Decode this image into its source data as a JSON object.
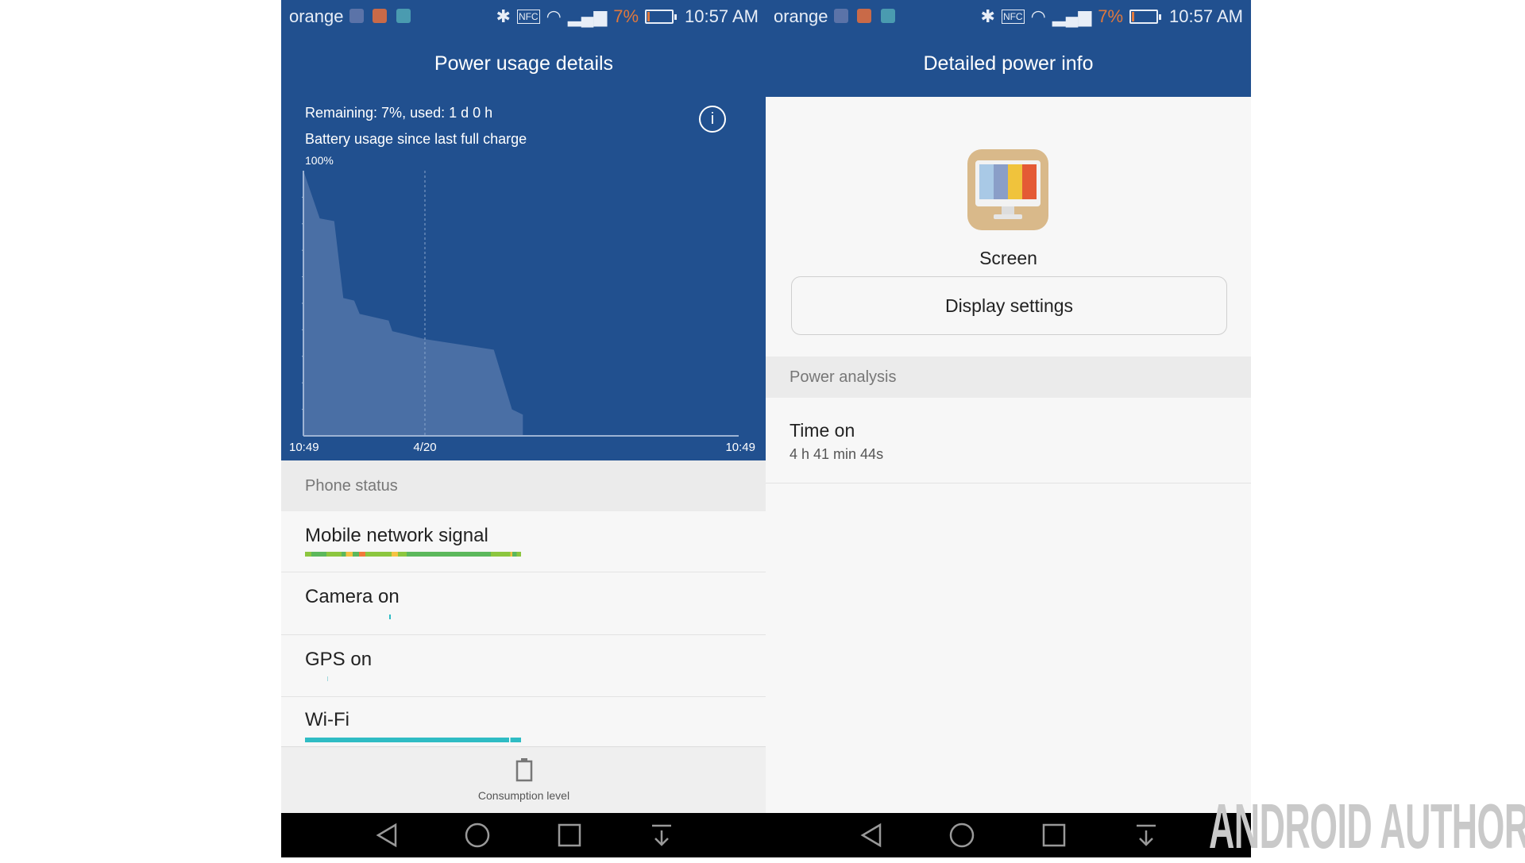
{
  "status_bar": {
    "carrier": "orange",
    "battery_percent": "7%",
    "time": "10:57 AM",
    "icons": [
      "heart-rate-icon",
      "battery-app-icon",
      "gallery-icon",
      "bluetooth-icon",
      "nfc-icon",
      "wifi-icon",
      "signal-icon",
      "battery-icon"
    ]
  },
  "left": {
    "title": "Power usage details",
    "remaining": "Remaining: 7%, used: 1 d 0 h",
    "subtitle": "Battery usage since last full charge",
    "info_icon": "info-icon",
    "phone_status_header": "Phone status",
    "rows": [
      {
        "label": "Mobile network signal"
      },
      {
        "label": "Camera on"
      },
      {
        "label": "GPS on"
      },
      {
        "label": "Wi-Fi"
      }
    ],
    "bottom_button": {
      "label": "Consumption level",
      "icon": "battery-icon"
    }
  },
  "chart_data": {
    "type": "area",
    "ylabel_top": "100%",
    "ylim": [
      0,
      100
    ],
    "xlim_hours": [
      0,
      24
    ],
    "x_tick_labels": [
      "10:49",
      "4/20",
      "10:49"
    ],
    "x_hours": [
      0,
      0.9,
      1.7,
      2.2,
      2.8,
      3.1,
      4.7,
      4.9,
      6.7,
      10.5,
      11.5,
      12.1
    ],
    "y_percent": [
      100,
      82,
      81,
      52,
      51,
      46,
      43.5,
      39.5,
      36.5,
      32.5,
      10,
      8
    ],
    "marker_hours": 6.7,
    "colors": {
      "fill": "#4a6fa5",
      "background": "#21508f"
    }
  },
  "right": {
    "title": "Detailed power info",
    "app_name": "Screen",
    "app_icon": "screen-monitor-icon",
    "button": "Display settings",
    "analysis_header": "Power analysis",
    "time_on_label": "Time on",
    "time_on_value": "4 h 41 min 44s"
  },
  "nav": [
    "back-icon",
    "home-icon",
    "recents-icon",
    "notifications-icon"
  ],
  "watermark": "ANDROID AUTHORITY",
  "colors": {
    "header": "#21508f",
    "wifi_bar": "#2fbcc4",
    "battery_low": "#e0783c"
  }
}
